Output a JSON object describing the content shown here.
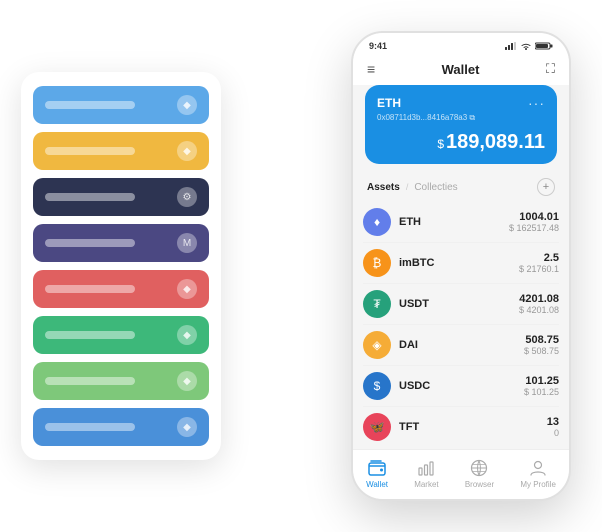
{
  "scene": {
    "cardStack": {
      "cards": [
        {
          "color": "#5ca8e8",
          "iconChar": "◆"
        },
        {
          "color": "#f0b840",
          "iconChar": "◆"
        },
        {
          "color": "#2d3452",
          "iconChar": "⚙"
        },
        {
          "color": "#4b4882",
          "iconChar": "M"
        },
        {
          "color": "#e06060",
          "iconChar": "◆"
        },
        {
          "color": "#3db87a",
          "iconChar": "◆"
        },
        {
          "color": "#7ec87a",
          "iconChar": "◆"
        },
        {
          "color": "#4a90d9",
          "iconChar": "◆"
        }
      ]
    },
    "phone": {
      "statusBar": {
        "time": "9:41",
        "icons": [
          "▪▪▪",
          "wifi",
          "battery"
        ]
      },
      "header": {
        "menuIcon": "≡",
        "title": "Wallet",
        "scanIcon": "⛶"
      },
      "ethCard": {
        "title": "ETH",
        "address": "0x08711d3b...8416a78a3 ⧉",
        "balanceDollar": "$",
        "balance": "189,089.11",
        "dotsLabel": "···"
      },
      "assetsSection": {
        "tabActive": "Assets",
        "tabDivider": "/",
        "tabInactive": "Collecties",
        "addLabel": "+"
      },
      "tokens": [
        {
          "name": "ETH",
          "amount": "1004.01",
          "usd": "$ 162517.48",
          "iconBg": "#627eea",
          "iconChar": "♦",
          "iconColor": "#fff"
        },
        {
          "name": "imBTC",
          "amount": "2.5",
          "usd": "$ 21760.1",
          "iconBg": "#f7931a",
          "iconChar": "₿",
          "iconColor": "#fff"
        },
        {
          "name": "USDT",
          "amount": "4201.08",
          "usd": "$ 4201.08",
          "iconBg": "#26a17b",
          "iconChar": "₮",
          "iconColor": "#fff"
        },
        {
          "name": "DAI",
          "amount": "508.75",
          "usd": "$ 508.75",
          "iconBg": "#f5ac37",
          "iconChar": "◈",
          "iconColor": "#fff"
        },
        {
          "name": "USDC",
          "amount": "101.25",
          "usd": "$ 101.25",
          "iconBg": "#2775ca",
          "iconChar": "$",
          "iconColor": "#fff"
        },
        {
          "name": "TFT",
          "amount": "13",
          "usd": "0",
          "iconBg": "#e8445a",
          "iconChar": "🦋",
          "iconColor": "#fff"
        }
      ],
      "bottomNav": [
        {
          "label": "Wallet",
          "active": true,
          "iconType": "wallet"
        },
        {
          "label": "Market",
          "active": false,
          "iconType": "market"
        },
        {
          "label": "Browser",
          "active": false,
          "iconType": "browser"
        },
        {
          "label": "My Profile",
          "active": false,
          "iconType": "profile"
        }
      ]
    }
  }
}
